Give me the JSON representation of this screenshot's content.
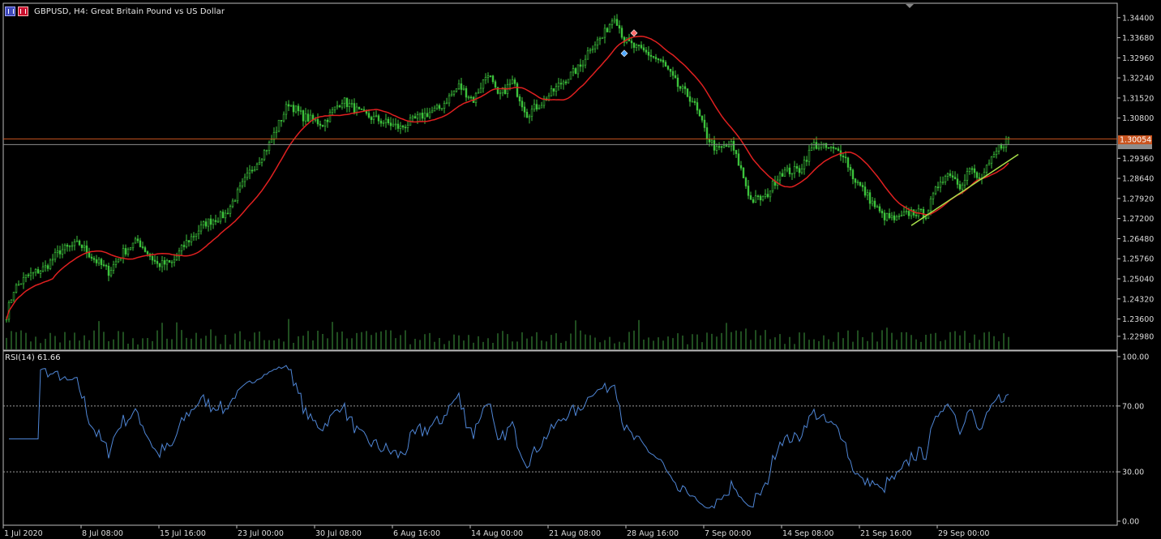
{
  "header": {
    "symbol_text": "GBPUSD, H4:  Great Britain Pound vs US Dollar",
    "icons": [
      "chart-type-icon",
      "flag-icon"
    ]
  },
  "price_axis": {
    "labels": [
      "1.34400",
      "1.33680",
      "1.32960",
      "1.32240",
      "1.31520",
      "1.30800",
      "1.29360",
      "1.28640",
      "1.27920",
      "1.27200",
      "1.26480",
      "1.25760",
      "1.25040",
      "1.24320",
      "1.23600",
      "1.22980"
    ],
    "current_price_tag": "1.30054",
    "bid_tag_partial": "1.29951"
  },
  "rsi": {
    "label": "RSI(14) 61.66",
    "axis_labels": [
      "100.00",
      "70.00",
      "30.00",
      "0.00"
    ],
    "levels": [
      70,
      30
    ]
  },
  "time_axis": {
    "labels": [
      "1 Jul 2020",
      "8 Jul 08:00",
      "15 Jul 16:00",
      "23 Jul 00:00",
      "30 Jul 08:00",
      "6 Aug 16:00",
      "14 Aug 00:00",
      "21 Aug 08:00",
      "28 Aug 16:00",
      "7 Sep 00:00",
      "14 Sep 08:00",
      "21 Sep 16:00",
      "29 Sep 00:00"
    ]
  },
  "colors": {
    "background": "#000000",
    "candle": "#3ec63e",
    "moving_average": "#e02020",
    "rsi_line": "#4f86d6",
    "volume": "#3f9b3f",
    "trendline": "#a8e04a",
    "current_price_line": "#c9541f",
    "grid_text": "#dcdcdc"
  },
  "chart_data": {
    "type": "candlestick",
    "x_labels": [
      "1 Jul 2020",
      "8 Jul 08:00",
      "15 Jul 16:00",
      "23 Jul 00:00",
      "30 Jul 08:00",
      "6 Aug 16:00",
      "14 Aug 00:00",
      "21 Aug 08:00",
      "28 Aug 16:00",
      "7 Sep 00:00",
      "14 Sep 08:00",
      "21 Sep 16:00",
      "29 Sep 00:00"
    ],
    "ylim": [
      1.226,
      1.348
    ],
    "close_anchors": [
      [
        0,
        1.2375
      ],
      [
        3,
        1.2465
      ],
      [
        8,
        1.251
      ],
      [
        16,
        1.2545
      ],
      [
        22,
        1.2605
      ],
      [
        30,
        1.263
      ],
      [
        36,
        1.2575
      ],
      [
        42,
        1.253
      ],
      [
        48,
        1.26
      ],
      [
        54,
        1.264
      ],
      [
        62,
        1.2555
      ],
      [
        68,
        1.256
      ],
      [
        74,
        1.2635
      ],
      [
        82,
        1.2705
      ],
      [
        90,
        1.2735
      ],
      [
        100,
        1.2885
      ],
      [
        108,
        1.2985
      ],
      [
        116,
        1.3135
      ],
      [
        122,
        1.3085
      ],
      [
        130,
        1.306
      ],
      [
        138,
        1.3145
      ],
      [
        146,
        1.3095
      ],
      [
        154,
        1.307
      ],
      [
        162,
        1.3045
      ],
      [
        170,
        1.3085
      ],
      [
        178,
        1.3115
      ],
      [
        186,
        1.3195
      ],
      [
        192,
        1.3145
      ],
      [
        198,
        1.3245
      ],
      [
        202,
        1.3155
      ],
      [
        208,
        1.321
      ],
      [
        214,
        1.3095
      ],
      [
        220,
        1.3135
      ],
      [
        228,
        1.3205
      ],
      [
        236,
        1.3265
      ],
      [
        240,
        1.3335
      ],
      [
        245,
        1.337
      ],
      [
        250,
        1.345
      ],
      [
        254,
        1.336
      ],
      [
        258,
        1.3335
      ],
      [
        264,
        1.331
      ],
      [
        270,
        1.3275
      ],
      [
        276,
        1.3195
      ],
      [
        282,
        1.3145
      ],
      [
        288,
        1.3015
      ],
      [
        292,
        1.2965
      ],
      [
        298,
        1.2985
      ],
      [
        302,
        1.2895
      ],
      [
        306,
        1.2785
      ],
      [
        312,
        1.2795
      ],
      [
        318,
        1.2885
      ],
      [
        326,
        1.2895
      ],
      [
        332,
        1.2985
      ],
      [
        338,
        1.297
      ],
      [
        344,
        1.2955
      ],
      [
        348,
        1.287
      ],
      [
        354,
        1.28
      ],
      [
        360,
        1.273
      ],
      [
        366,
        1.2715
      ],
      [
        372,
        1.2745
      ],
      [
        378,
        1.2735
      ],
      [
        384,
        1.286
      ],
      [
        388,
        1.2885
      ],
      [
        392,
        1.284
      ],
      [
        396,
        1.29
      ],
      [
        400,
        1.2855
      ],
      [
        404,
        1.291
      ],
      [
        408,
        1.2975
      ],
      [
        412,
        1.3005
      ]
    ],
    "bar_count": 413,
    "ma_period": 20,
    "rsi_period": 14,
    "rsi_ylim": [
      0,
      100
    ],
    "rsi_last": 61.66,
    "current_price": 1.30054,
    "trendline": {
      "from": [
        372,
        1.2695
      ],
      "to": [
        416,
        1.295
      ]
    },
    "markers": [
      {
        "type": "sell-arrow",
        "bar": 258,
        "price": 1.3385
      },
      {
        "type": "buy-arrow",
        "bar": 254,
        "price": 1.3312
      }
    ]
  }
}
